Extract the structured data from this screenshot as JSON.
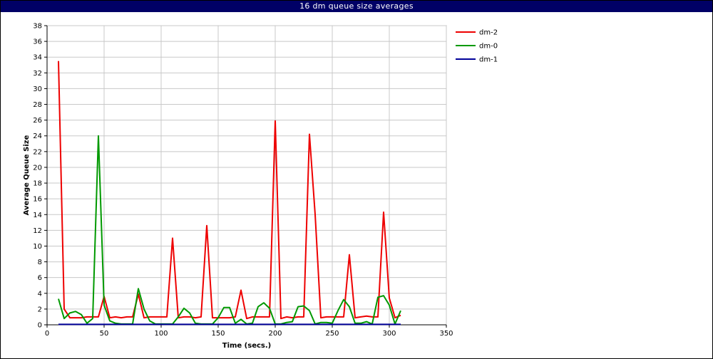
{
  "chart_data": {
    "type": "line",
    "title": "16 dm queue size averages",
    "xlabel": "Time (secs.)",
    "ylabel": "Average Queue Size",
    "xlim": [
      0,
      350
    ],
    "ylim": [
      0,
      38
    ],
    "x_ticks": [
      0,
      50,
      100,
      150,
      200,
      250,
      300,
      350
    ],
    "y_ticks": [
      0,
      2,
      4,
      6,
      8,
      10,
      12,
      14,
      16,
      18,
      20,
      22,
      24,
      26,
      28,
      30,
      32,
      34,
      36,
      38
    ],
    "grid": true,
    "legend_position": "right",
    "series": [
      {
        "name": "dm-2",
        "color": "#ee0000",
        "x": [
          10,
          15,
          20,
          25,
          30,
          35,
          40,
          45,
          50,
          55,
          60,
          65,
          70,
          75,
          80,
          85,
          90,
          95,
          100,
          105,
          110,
          115,
          120,
          125,
          130,
          135,
          140,
          145,
          150,
          155,
          160,
          165,
          170,
          175,
          180,
          185,
          190,
          195,
          200,
          205,
          210,
          215,
          220,
          225,
          230,
          235,
          240,
          245,
          250,
          255,
          260,
          265,
          270,
          275,
          280,
          285,
          290,
          295,
          300,
          305,
          310
        ],
        "values": [
          33.5,
          2,
          0.9,
          0.9,
          0.9,
          1,
          1,
          1,
          3.6,
          0.9,
          1,
          0.9,
          1,
          1,
          3.9,
          0.9,
          1,
          1,
          1,
          1,
          11,
          0.9,
          1,
          1,
          0.9,
          1,
          12.6,
          0.9,
          0.9,
          0.9,
          0.9,
          1,
          4.4,
          0.8,
          1,
          1,
          1,
          1,
          25.9,
          0.8,
          1,
          0.9,
          1,
          1,
          24.2,
          14,
          0.9,
          1,
          1,
          1,
          1,
          8.9,
          0.9,
          1,
          1.1,
          1,
          1,
          14.3,
          3.4,
          0.9,
          1.2
        ]
      },
      {
        "name": "dm-0",
        "color": "#009900",
        "x": [
          10,
          15,
          20,
          25,
          30,
          35,
          40,
          45,
          50,
          55,
          60,
          65,
          70,
          75,
          80,
          85,
          90,
          95,
          100,
          105,
          110,
          115,
          120,
          125,
          130,
          135,
          140,
          145,
          150,
          155,
          160,
          165,
          170,
          175,
          180,
          185,
          190,
          195,
          200,
          205,
          210,
          215,
          220,
          225,
          230,
          235,
          240,
          245,
          250,
          255,
          260,
          265,
          270,
          275,
          280,
          285,
          290,
          295,
          300,
          305,
          310
        ],
        "values": [
          3.3,
          0.8,
          1.5,
          1.7,
          1.3,
          0.2,
          0.8,
          24,
          2.5,
          0.5,
          0.2,
          0.1,
          0.1,
          0.1,
          4.6,
          2,
          0.5,
          0.1,
          0.1,
          0.1,
          0.1,
          1,
          2.1,
          1.5,
          0.2,
          0.1,
          0.1,
          0.1,
          0.9,
          2.2,
          2.2,
          0.2,
          0.7,
          0.1,
          0.2,
          2.3,
          2.8,
          2.1,
          0.1,
          0.1,
          0.3,
          0.4,
          2.3,
          2.4,
          1.8,
          0.1,
          0.3,
          0.3,
          0.2,
          1.8,
          3.2,
          2.3,
          0.2,
          0.2,
          0.4,
          0.1,
          3.5,
          3.7,
          2.5,
          0.1,
          1.8
        ]
      },
      {
        "name": "dm-1",
        "color": "#000099",
        "x": [
          10,
          310
        ],
        "values": [
          0.05,
          0.05
        ]
      }
    ]
  }
}
